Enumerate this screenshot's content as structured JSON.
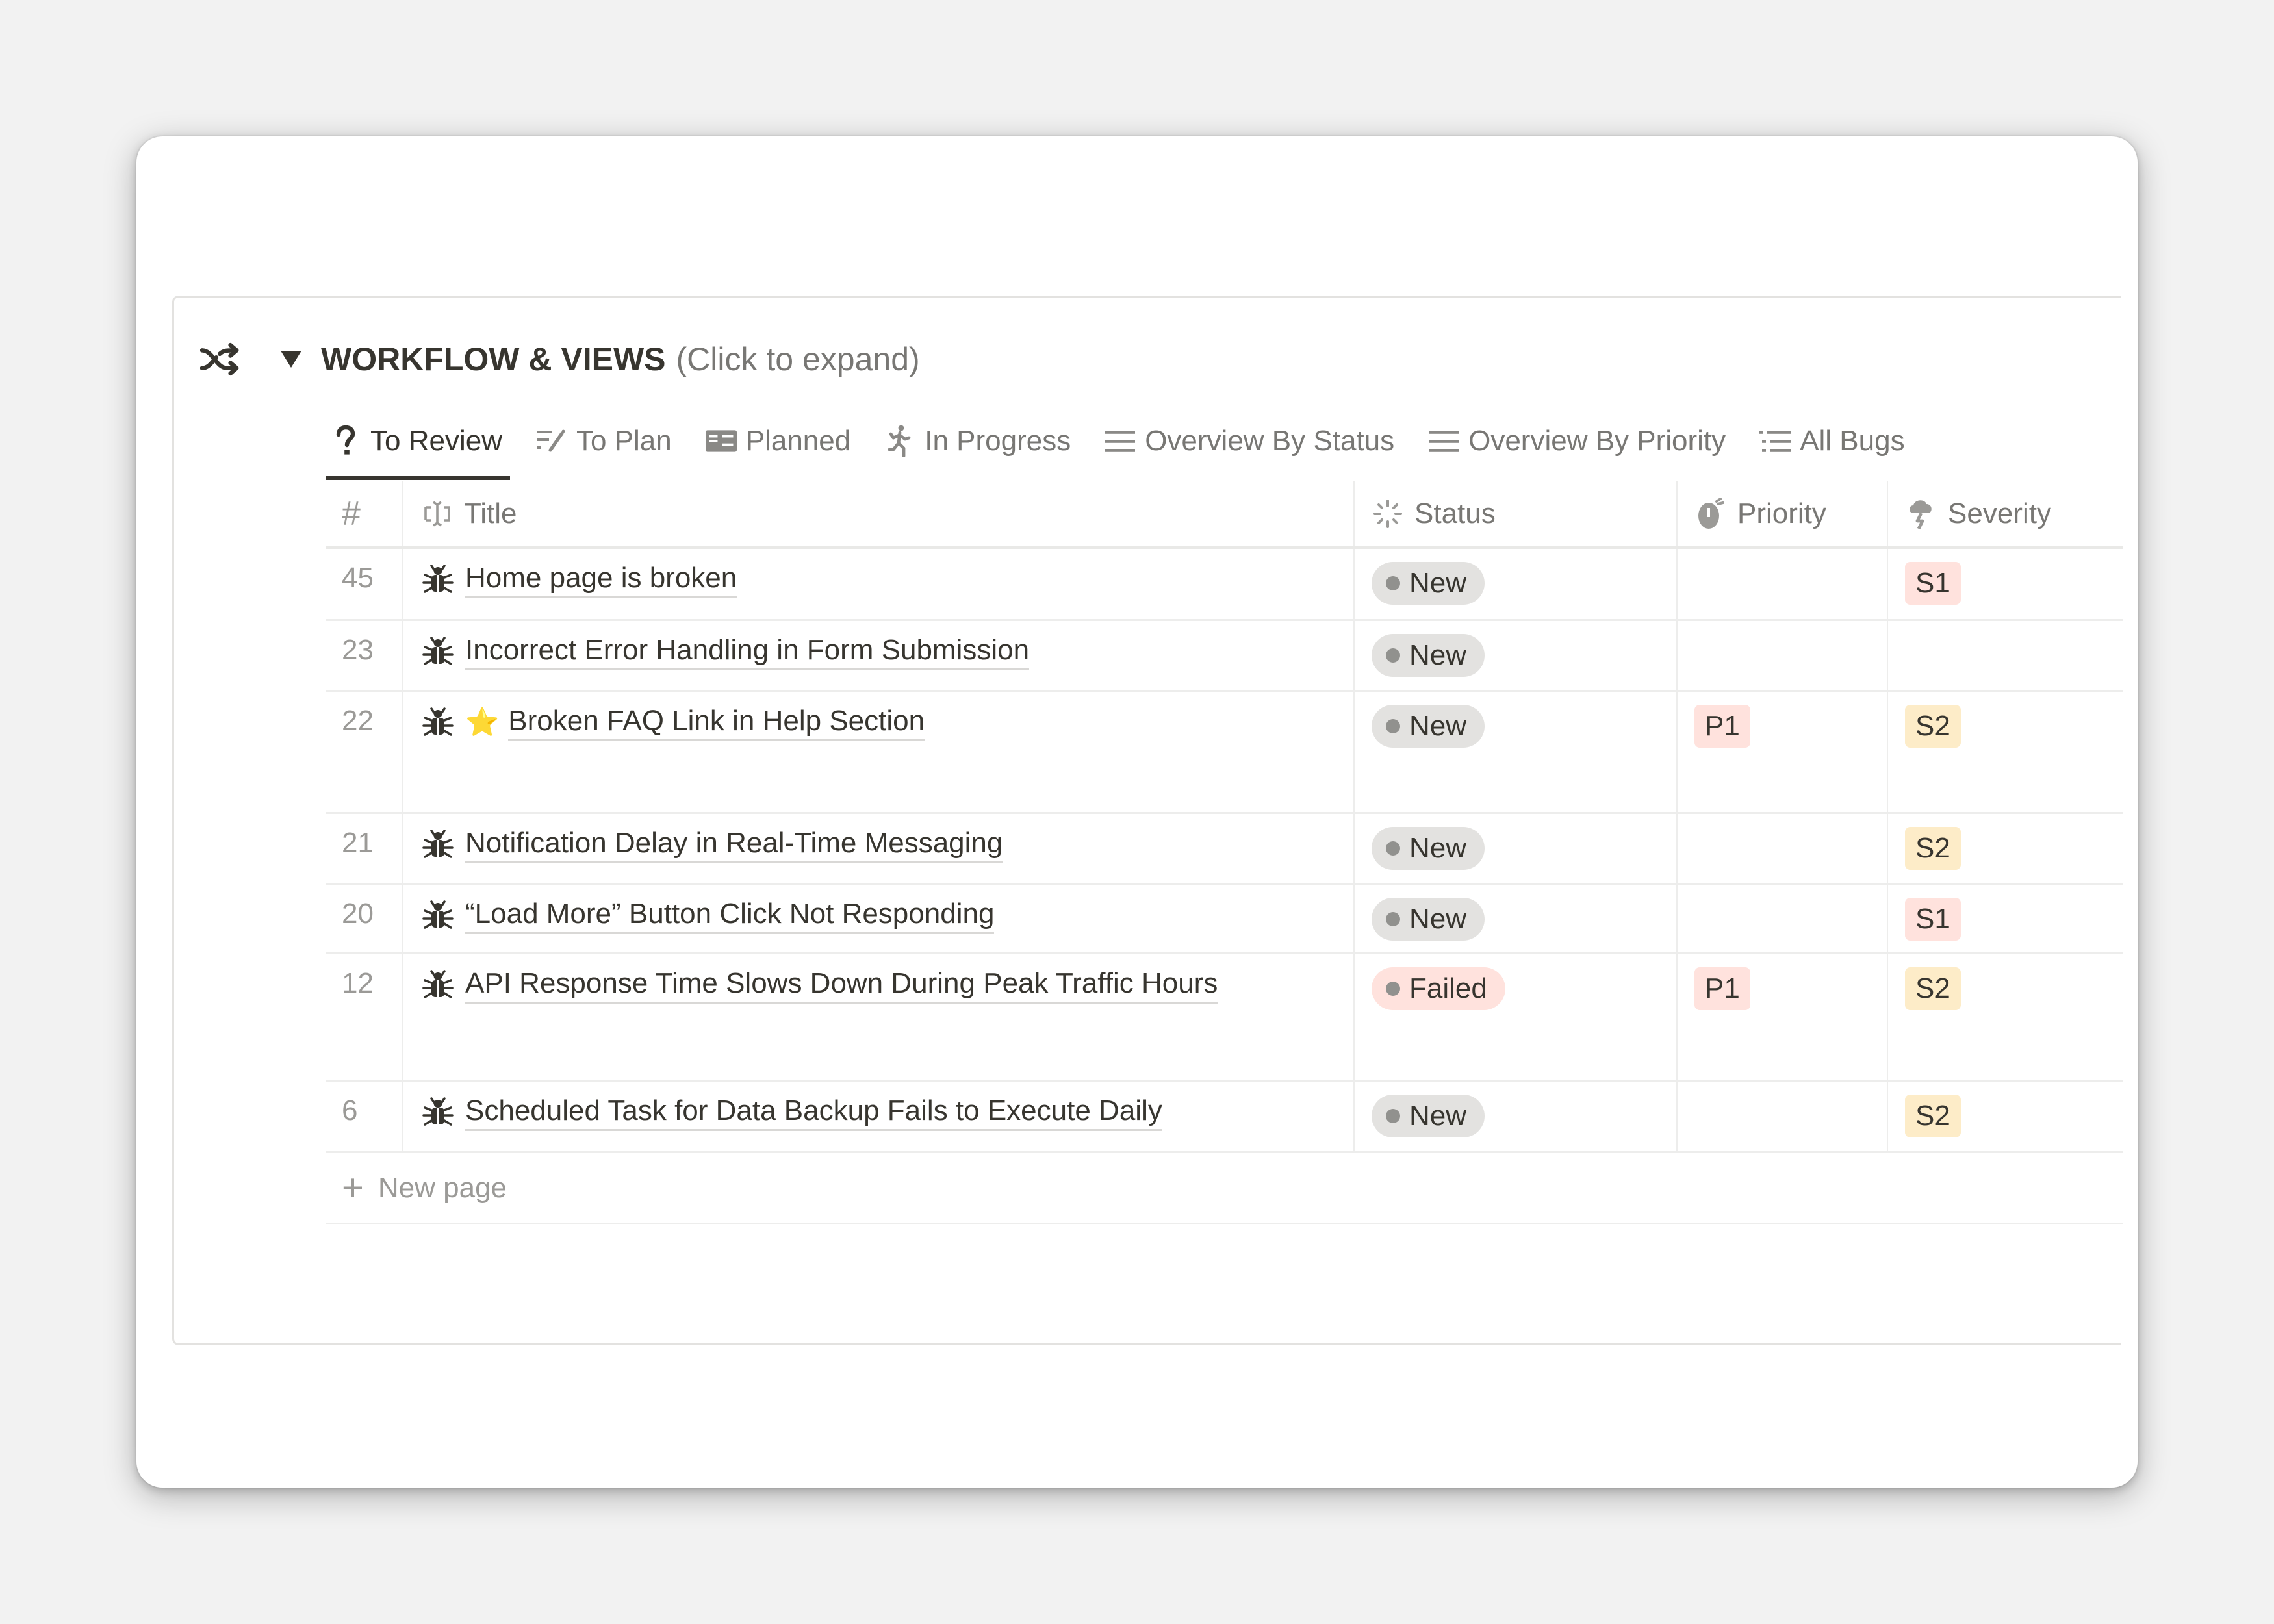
{
  "callout": {
    "icon": "shuffle-icon",
    "title": "WORKFLOW & VIEWS",
    "subtitle": "(Click to expand)"
  },
  "tabs": [
    {
      "label": "To Review",
      "icon": "question-icon",
      "active": true
    },
    {
      "label": "To Plan",
      "icon": "list-pencil-icon",
      "active": false
    },
    {
      "label": "Planned",
      "icon": "board-icon",
      "active": false
    },
    {
      "label": "In Progress",
      "icon": "running-person-icon",
      "active": false
    },
    {
      "label": "Overview By Status",
      "icon": "list-lines-icon",
      "active": false
    },
    {
      "label": "Overview By Priority",
      "icon": "list-lines-icon",
      "active": false
    },
    {
      "label": "All Bugs",
      "icon": "bulleted-list-icon",
      "active": false
    }
  ],
  "table": {
    "columns": [
      {
        "label": "#",
        "icon": null
      },
      {
        "label": "Title",
        "icon": "text-cursor-icon"
      },
      {
        "label": "Status",
        "icon": "loading-spinner-icon"
      },
      {
        "label": "Priority",
        "icon": "stopwatch-icon"
      },
      {
        "label": "Severity",
        "icon": "storm-cloud-icon"
      }
    ],
    "rows": [
      {
        "num": "45",
        "title": "Home page is broken",
        "starred": false,
        "status": "New",
        "priority": "",
        "severity": "S1"
      },
      {
        "num": "23",
        "title": "Incorrect Error Handling in Form Submission",
        "starred": false,
        "status": "New",
        "priority": "",
        "severity": ""
      },
      {
        "num": "22",
        "title": "Broken FAQ Link in Help Section",
        "starred": true,
        "status": "New",
        "priority": "P1",
        "severity": "S2"
      },
      {
        "num": "21",
        "title": "Notification Delay in Real-Time Messaging",
        "starred": false,
        "status": "New",
        "priority": "",
        "severity": "S2"
      },
      {
        "num": "20",
        "title": "“Load More” Button Click Not Responding",
        "starred": false,
        "status": "New",
        "priority": "",
        "severity": "S1"
      },
      {
        "num": "12",
        "title": "API Response Time Slows Down During Peak Traffic Hours",
        "starred": false,
        "status": "Failed",
        "priority": "P1",
        "severity": "S2"
      },
      {
        "num": "6",
        "title": "Scheduled Task for Data Backup Fails to Execute Daily",
        "starred": false,
        "status": "New",
        "priority": "",
        "severity": "S2"
      }
    ],
    "new_page_label": "New page"
  },
  "colors": {
    "status_new_bg": "#e3e2e0",
    "status_failed_bg": "#ffe2dd",
    "status_dot": "#91918e",
    "tag_s1_bg": "#ffe2dd",
    "tag_s2_bg": "#fdecc8",
    "tag_p1_bg": "#ffe2dd",
    "text_primary": "#37352f",
    "text_secondary": "#787774"
  }
}
